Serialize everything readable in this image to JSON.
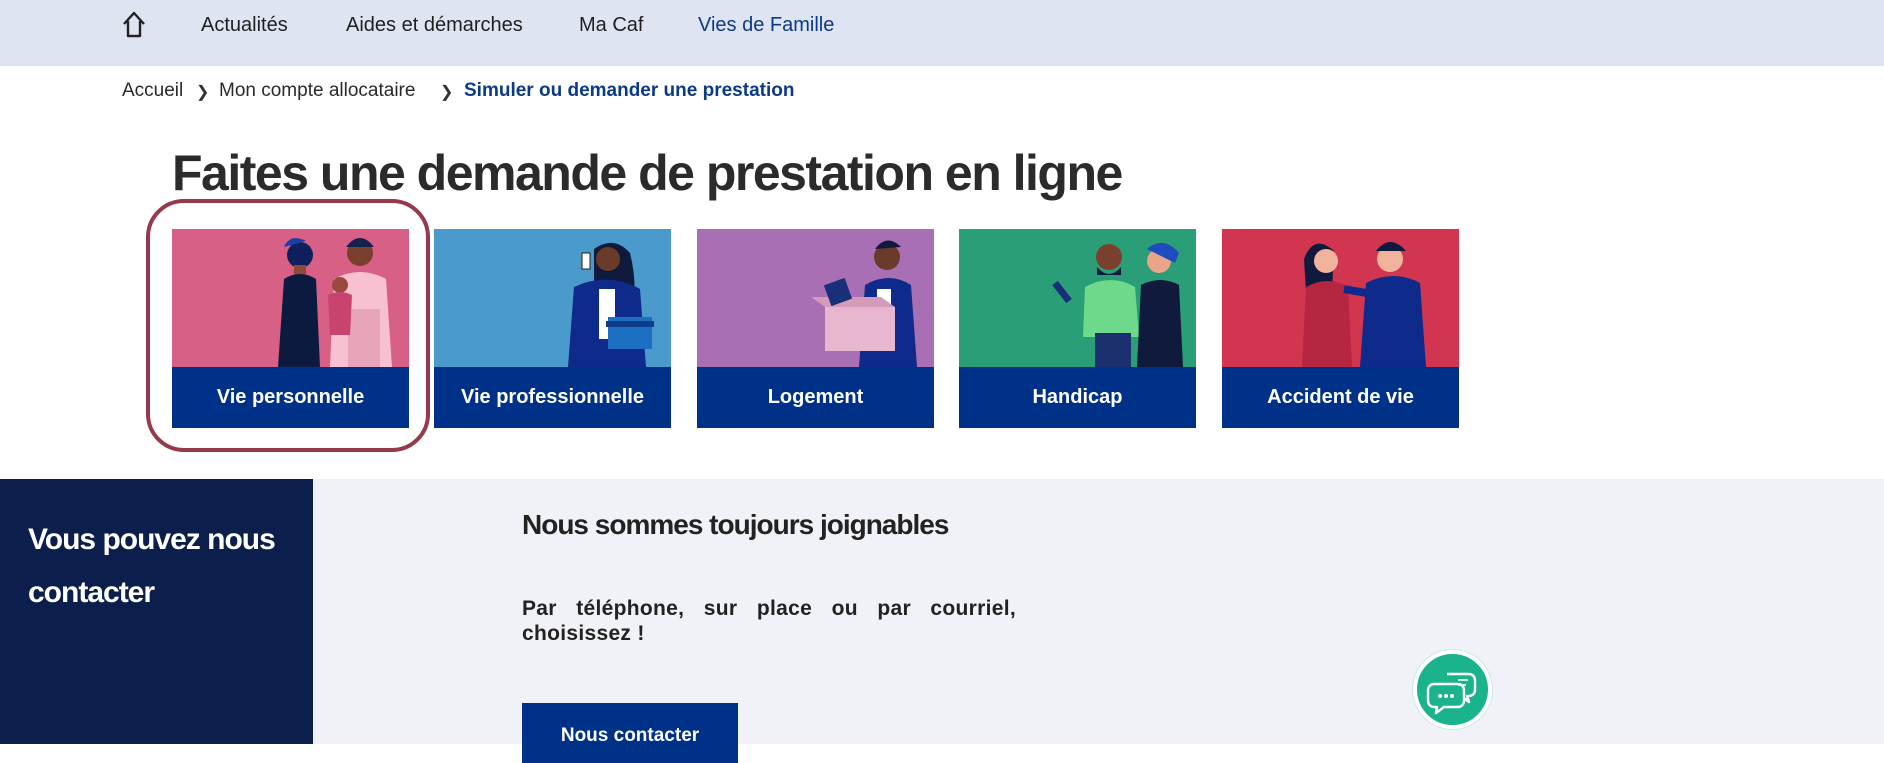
{
  "topnav": {
    "home_icon": "home-icon",
    "items": [
      {
        "label": "Actualités"
      },
      {
        "label": "Aides et démarches"
      },
      {
        "label": "Ma Caf"
      },
      {
        "label": "Vies de Famille"
      }
    ],
    "active_color": "#0b3a86",
    "background": "#dfe4f2"
  },
  "breadcrumb": {
    "items": [
      "Accueil",
      "Mon compte allocataire"
    ],
    "current": "Simuler ou demander une prestation",
    "separator_icon": "chevron-right-icon"
  },
  "page": {
    "title": "Faites une demande de prestation en ligne"
  },
  "cards": [
    {
      "label": "Vie personnelle",
      "bg": "#d85f86",
      "illustration": "family-illustration"
    },
    {
      "label": "Vie professionnelle",
      "bg": "#4a9acb",
      "illustration": "professional-woman-illustration"
    },
    {
      "label": "Logement",
      "bg": "#a96fb5",
      "illustration": "moving-box-illustration"
    },
    {
      "label": "Handicap",
      "bg": "#2a9e77",
      "illustration": "couple-prosthesis-illustration"
    },
    {
      "label": "Accident de vie",
      "bg": "#d23550",
      "illustration": "comforting-couple-illustration"
    }
  ],
  "contact": {
    "sidebar_heading": "Vous pouvez nous contacter",
    "title": "Nous sommes toujours joignables",
    "text": "Par téléphone, sur place ou par courriel, choisissez !",
    "button_label": "Nous contacter",
    "chat_icon": "chat-bubbles-icon"
  },
  "colors": {
    "brand_blue": "#003189",
    "dark_navy": "#0c1f4c",
    "highlight_ring": "#963a4b",
    "chat_green": "#1bb38c"
  }
}
